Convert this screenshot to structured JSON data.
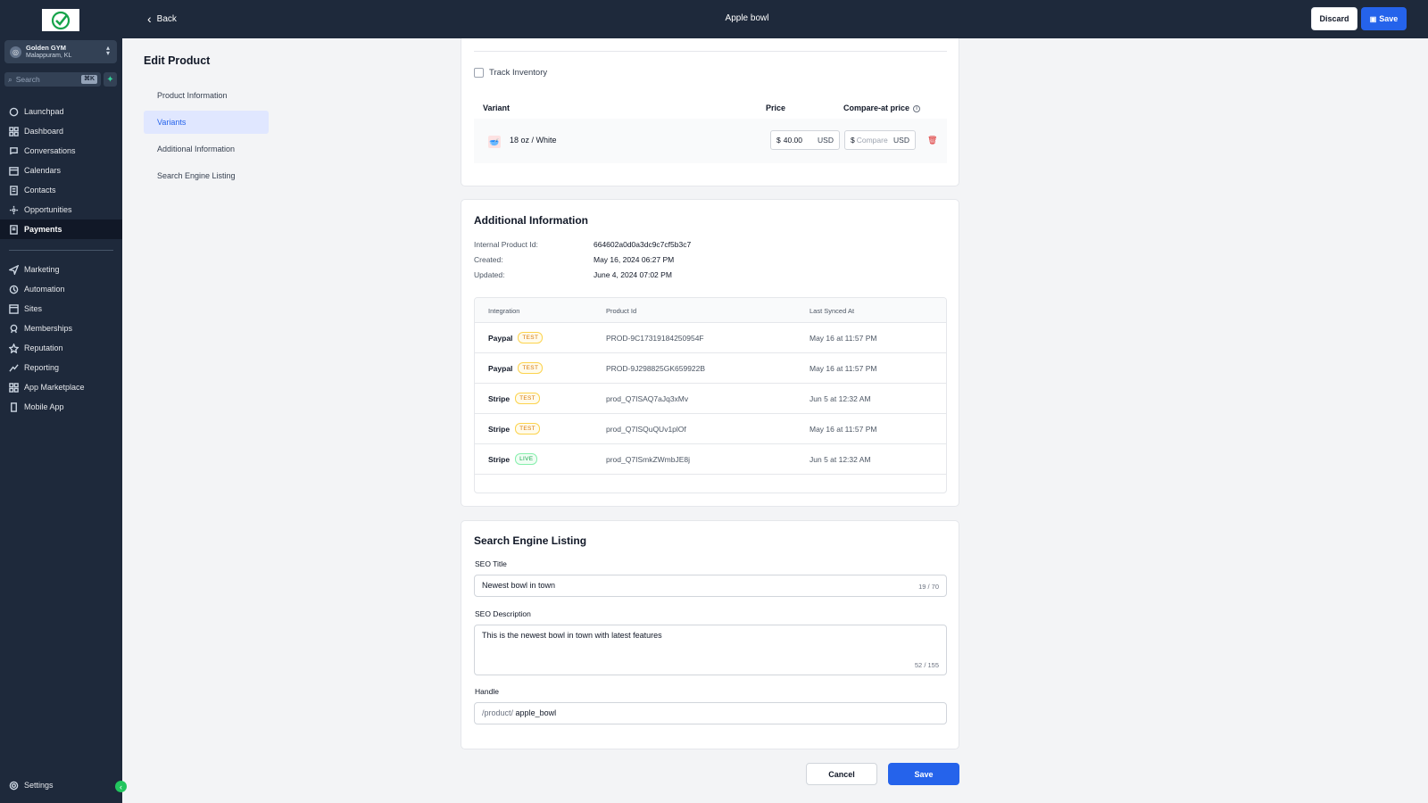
{
  "sidebar": {
    "account_name": "Golden GYM",
    "account_location": "Malappuram, KL",
    "search_placeholder": "Search",
    "search_shortcut": "⌘K",
    "items": [
      {
        "label": "Launchpad",
        "icon": "rocket-icon"
      },
      {
        "label": "Dashboard",
        "icon": "grid-icon"
      },
      {
        "label": "Conversations",
        "icon": "chat-icon"
      },
      {
        "label": "Calendars",
        "icon": "calendar-icon"
      },
      {
        "label": "Contacts",
        "icon": "contacts-icon"
      },
      {
        "label": "Opportunities",
        "icon": "opportunities-icon"
      },
      {
        "label": "Payments",
        "icon": "payments-icon",
        "active": true
      },
      {
        "label": "Marketing",
        "icon": "send-icon"
      },
      {
        "label": "Automation",
        "icon": "automation-icon"
      },
      {
        "label": "Sites",
        "icon": "sites-icon"
      },
      {
        "label": "Memberships",
        "icon": "award-icon"
      },
      {
        "label": "Reputation",
        "icon": "star-icon"
      },
      {
        "label": "Reporting",
        "icon": "trend-icon"
      },
      {
        "label": "App Marketplace",
        "icon": "apps-icon"
      },
      {
        "label": "Mobile App",
        "icon": "mobile-icon"
      }
    ],
    "settings_label": "Settings"
  },
  "topbar": {
    "back_label": "Back",
    "title": "Apple bowl",
    "discard_label": "Discard",
    "save_label": "Save"
  },
  "page": {
    "title": "Edit Product",
    "sections": [
      {
        "label": "Product Information"
      },
      {
        "label": "Variants",
        "active": true
      },
      {
        "label": "Additional Information"
      },
      {
        "label": "Search Engine Listing"
      }
    ]
  },
  "variants": {
    "track_inventory_label": "Track Inventory",
    "track_inventory_checked": false,
    "header_variant": "Variant",
    "header_price": "Price",
    "header_compare": "Compare-at price",
    "rows": [
      {
        "name": "18 oz / White",
        "price_prefix": "$",
        "price": "40.00",
        "currency": "USD",
        "compare_prefix": "$",
        "compare_placeholder": "Compare",
        "compare_currency": "USD"
      }
    ]
  },
  "additional": {
    "title": "Additional Information",
    "internal_id_label": "Internal Product Id:",
    "internal_id": "664602a0d0a3dc9c7cf5b3c7",
    "created_label": "Created:",
    "created": "May 16, 2024 06:27 PM",
    "updated_label": "Updated:",
    "updated": "June 4, 2024 07:02 PM",
    "table_headers": {
      "integration": "Integration",
      "product_id": "Product Id",
      "last_synced": "Last Synced At"
    },
    "integrations": [
      {
        "name": "Paypal",
        "badge": "TEST",
        "product_id": "PROD-9C17319184250954F",
        "synced": "May 16 at 11:57 PM"
      },
      {
        "name": "Paypal",
        "badge": "TEST",
        "product_id": "PROD-9J298825GK659922B",
        "synced": "May 16 at 11:57 PM"
      },
      {
        "name": "Stripe",
        "badge": "TEST",
        "product_id": "prod_Q7ISAQ7aJq3xMv",
        "synced": "Jun 5 at 12:32 AM"
      },
      {
        "name": "Stripe",
        "badge": "TEST",
        "product_id": "prod_Q7ISQuQUv1plOf",
        "synced": "May 16 at 11:57 PM"
      },
      {
        "name": "Stripe",
        "badge": "LIVE",
        "product_id": "prod_Q7ISmkZWmbJE8j",
        "synced": "Jun 5 at 12:32 AM"
      }
    ]
  },
  "seo": {
    "title": "Search Engine Listing",
    "seo_title_label": "SEO Title",
    "seo_title_value": "Newest bowl in town",
    "seo_title_counter": "19 / 70",
    "seo_desc_label": "SEO Description",
    "seo_desc_value": "This is the newest bowl in town with latest features",
    "seo_desc_counter": "52 / 155",
    "handle_label": "Handle",
    "handle_prefix": "/product/",
    "handle_value": "apple_bowl"
  },
  "footer": {
    "cancel_label": "Cancel",
    "save_label": "Save"
  },
  "colors": {
    "sidebar_bg": "#1e293b",
    "accent": "#2563eb",
    "test_badge": "#d97706",
    "live_badge": "#16a34a",
    "delete": "#dc2626"
  }
}
